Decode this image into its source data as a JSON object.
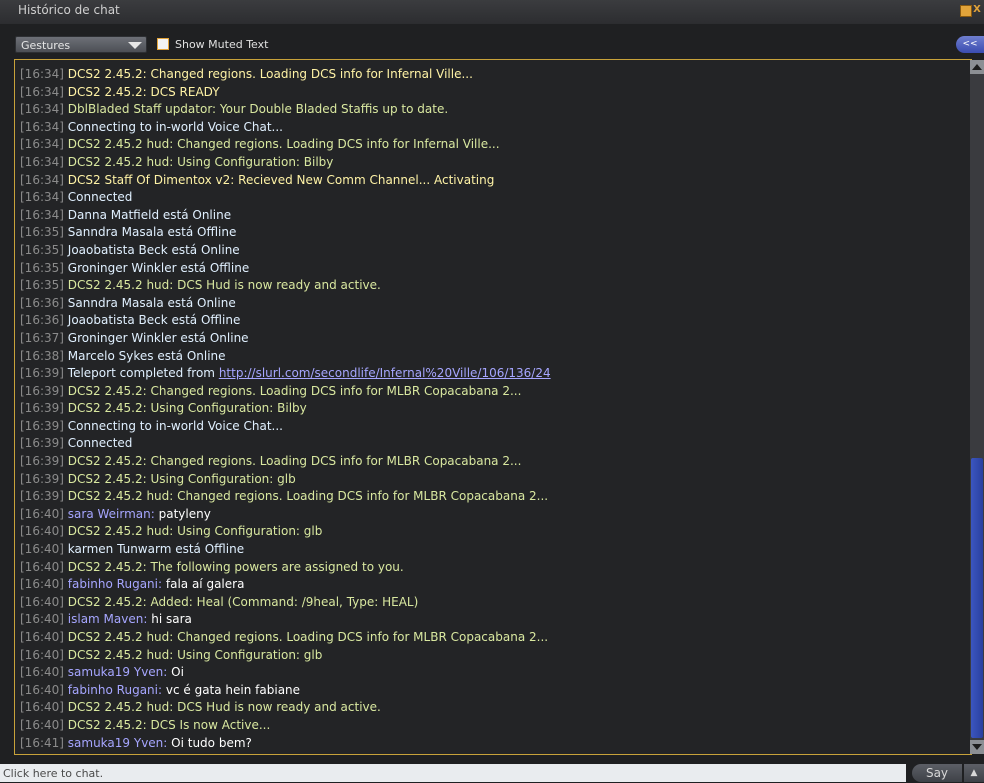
{
  "window": {
    "title": "Histórico de chat",
    "min_icon": "minimize-icon",
    "close_icon": "close-icon",
    "close_glyph": "X"
  },
  "toolbar": {
    "gesture_value": "Gestures",
    "show_muted_label": "Show Muted Text",
    "show_muted_checked": false,
    "collapse_label": "<<"
  },
  "colors": {
    "accent": "#e2a43a",
    "system": "#fff3a6",
    "object": "#d9e8a0",
    "notify": "#e0f0ff",
    "name": "#a6a6ff",
    "timestamp": "#8b8b8b",
    "scroll_thumb": "#3a4cb0"
  },
  "scroll": {
    "position": "bottom"
  },
  "lines": [
    {
      "ts": "[16:34]",
      "t": "c-sys",
      "text": "DCS2 2.45.2: Changed regions. Loading DCS info for Infernal Ville..."
    },
    {
      "ts": "[16:34]",
      "t": "c-sys",
      "text": "DCS2 2.45.2: DCS READY"
    },
    {
      "ts": "[16:34]",
      "t": "c-obj",
      "text": "DblBladed Staff updator: Your Double Bladed Staffis up to date."
    },
    {
      "ts": "[16:34]",
      "t": "c-nf",
      "text": "Connecting to in-world Voice Chat..."
    },
    {
      "ts": "[16:34]",
      "t": "c-obj",
      "text": "DCS2 2.45.2 hud: Changed regions. Loading DCS info for Infernal Ville..."
    },
    {
      "ts": "[16:34]",
      "t": "c-obj",
      "text": "DCS2 2.45.2 hud: Using Configuration: Bilby"
    },
    {
      "ts": "[16:34]",
      "t": "c-sys",
      "text": "DCS2 Staff Of Dimentox v2: Recieved New Comm Channel... Activating"
    },
    {
      "ts": "[16:34]",
      "t": "c-nf",
      "text": "Connected"
    },
    {
      "ts": "[16:34]",
      "t": "c-nf",
      "text": "Danna Matfield está Online"
    },
    {
      "ts": "[16:35]",
      "t": "c-nf",
      "text": "Sanndra Masala está Offline"
    },
    {
      "ts": "[16:35]",
      "t": "c-nf",
      "text": "Joaobatista Beck está Online"
    },
    {
      "ts": "[16:35]",
      "t": "c-nf",
      "text": "Groninger Winkler está Offline"
    },
    {
      "ts": "[16:35]",
      "t": "c-obj",
      "text": "DCS2 2.45.2 hud: DCS Hud is now ready and active."
    },
    {
      "ts": "[16:36]",
      "t": "c-nf",
      "text": "Sanndra Masala está Online"
    },
    {
      "ts": "[16:36]",
      "t": "c-nf",
      "text": "Joaobatista Beck está Offline"
    },
    {
      "ts": "[16:37]",
      "t": "c-nf",
      "text": "Groninger Winkler está Online"
    },
    {
      "ts": "[16:38]",
      "t": "c-nf",
      "text": "Marcelo Sykes está Online"
    },
    {
      "ts": "[16:39]",
      "t": "c-nf",
      "text": "Teleport completed from ",
      "link": "http://slurl.com/secondlife/Infernal%20Ville/106/136/24"
    },
    {
      "ts": "[16:39]",
      "t": "c-obj",
      "text": "DCS2 2.45.2: Changed regions. Loading DCS info for MLBR Copacabana 2..."
    },
    {
      "ts": "[16:39]",
      "t": "c-obj",
      "text": "DCS2 2.45.2: Using Configuration: Bilby"
    },
    {
      "ts": "[16:39]",
      "t": "c-nf",
      "text": "Connecting to in-world Voice Chat..."
    },
    {
      "ts": "[16:39]",
      "t": "c-nf",
      "text": "Connected"
    },
    {
      "ts": "[16:39]",
      "t": "c-obj",
      "text": "DCS2 2.45.2: Changed regions. Loading DCS info for MLBR Copacabana 2..."
    },
    {
      "ts": "[16:39]",
      "t": "c-obj",
      "text": "DCS2 2.45.2: Using Configuration: glb"
    },
    {
      "ts": "[16:39]",
      "t": "c-obj",
      "text": "DCS2 2.45.2 hud: Changed regions. Loading DCS info for MLBR Copacabana 2..."
    },
    {
      "ts": "[16:40]",
      "name": "sara Weirman:",
      "text": "patyleny"
    },
    {
      "ts": "[16:40]",
      "t": "c-obj",
      "text": "DCS2 2.45.2 hud: Using Configuration: glb"
    },
    {
      "ts": "[16:40]",
      "t": "c-nf",
      "text": "karmen Tunwarm está Offline"
    },
    {
      "ts": "[16:40]",
      "t": "c-obj",
      "text": "DCS2 2.45.2: The following powers are assigned to you."
    },
    {
      "ts": "[16:40]",
      "name": "fabinho Rugani:",
      "text": "fala aí galera"
    },
    {
      "ts": "[16:40]",
      "t": "c-obj",
      "text": "DCS2 2.45.2: Added: Heal (Command: /9heal, Type: HEAL)"
    },
    {
      "ts": "[16:40]",
      "name": "islam Maven:",
      "text": "hi sara"
    },
    {
      "ts": "[16:40]",
      "t": "c-obj",
      "text": "DCS2 2.45.2 hud: Changed regions. Loading DCS info for MLBR Copacabana 2..."
    },
    {
      "ts": "[16:40]",
      "t": "c-obj",
      "text": "DCS2 2.45.2 hud: Using Configuration: glb"
    },
    {
      "ts": "[16:40]",
      "name": "samuka19 Yven:",
      "text": "Oi"
    },
    {
      "ts": "[16:40]",
      "name": "fabinho Rugani:",
      "text": "vc é gata hein fabiane"
    },
    {
      "ts": "[16:40]",
      "t": "c-obj",
      "text": "DCS2 2.45.2 hud: DCS Hud is now ready and active."
    },
    {
      "ts": "[16:40]",
      "t": "c-obj",
      "text": "DCS2 2.45.2: DCS Is now Active..."
    },
    {
      "ts": "[16:41]",
      "name": "samuka19 Yven:",
      "text": "Oi tudo bem?"
    }
  ],
  "chatbar": {
    "placeholder": "Click here to chat.",
    "say_label": "Say",
    "expand_icon": "chevron-up-icon",
    "expand_glyph": "▲"
  }
}
